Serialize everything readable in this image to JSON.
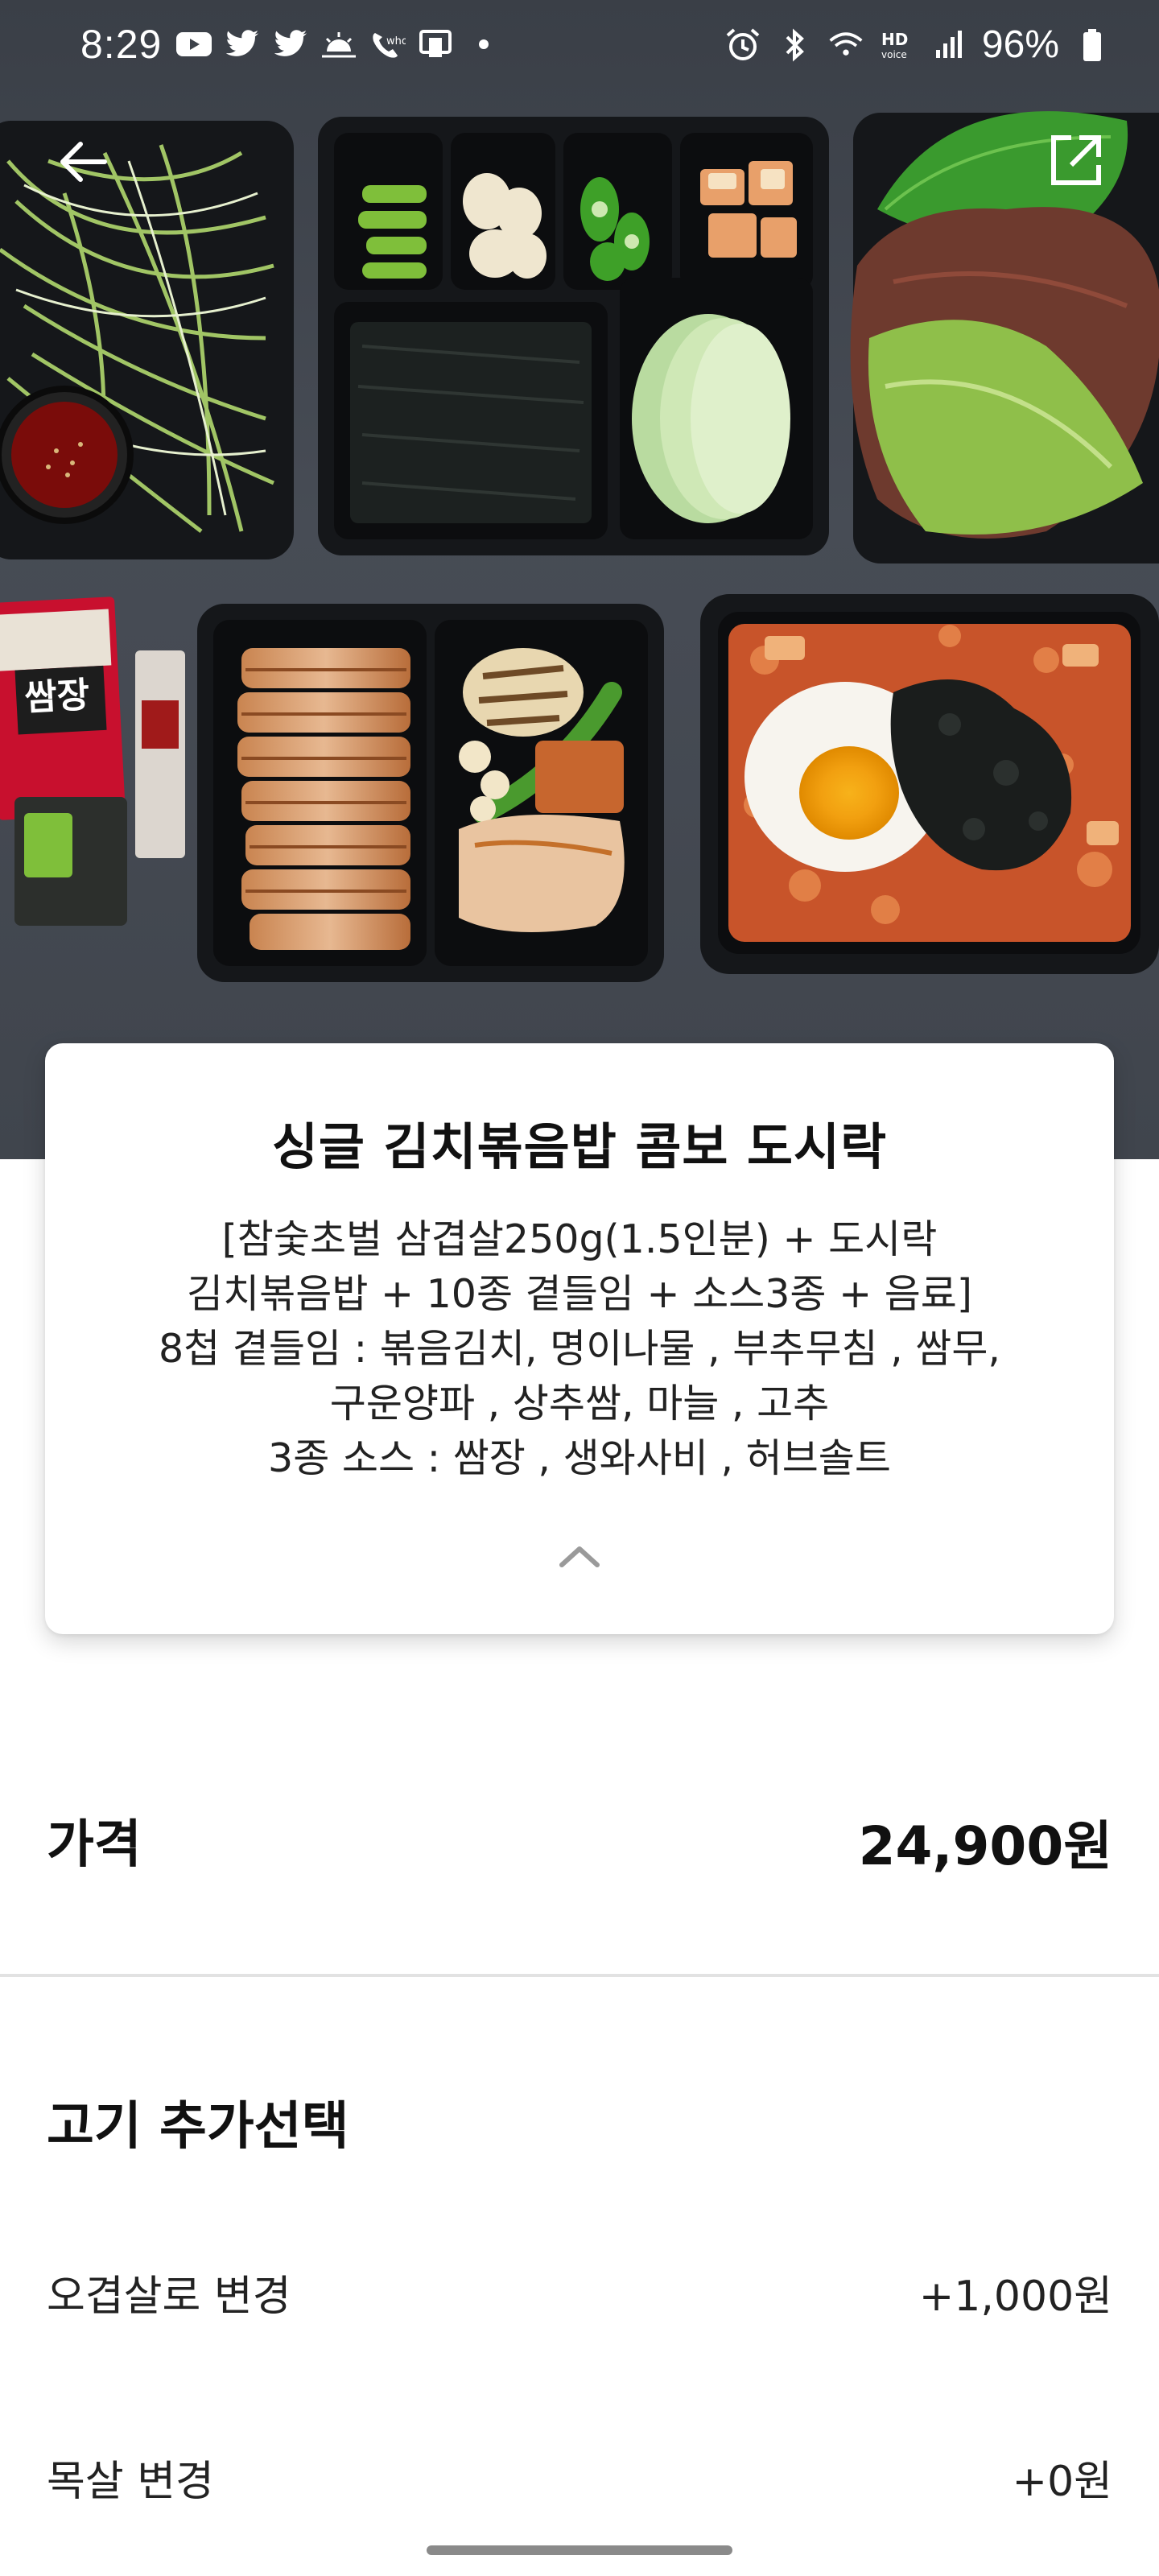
{
  "status_bar": {
    "time": "8:29",
    "battery": "96%",
    "left_icons": [
      "youtube-icon",
      "twitter-icon",
      "twitter-icon",
      "weather-icon",
      "call-icon",
      "cast-icon",
      "dot-icon"
    ],
    "right_icons": [
      "alarm-icon",
      "bluetooth-icon",
      "wifi-icon",
      "hd-voice-icon",
      "signal-icon",
      "battery-icon"
    ]
  },
  "hero": {
    "sauce_label_1": "쌈장"
  },
  "product": {
    "title": "싱글 김치볶음밥 콤보 도시락",
    "description_lines": [
      "[참숯초벌 삼겹살250g(1.5인분) + 도시락",
      "김치볶음밥 + 10종 곁들임 + 소스3종 + 음료]",
      "8첩 곁들임 : 볶음김치, 명이나물 , 부추무침 , 쌈무,",
      "구운양파 , 상추쌈, 마늘 , 고추",
      "3종 소스 : 쌈장 , 생와사비 , 허브솔트"
    ]
  },
  "price": {
    "label": "가격",
    "value": "24,900원"
  },
  "options": {
    "section_title": "고기 추가선택",
    "items": [
      {
        "label": "오겹살로 변경",
        "price": "+1,000원"
      },
      {
        "label": "목살 변경",
        "price": "+0원"
      }
    ]
  },
  "colors": {
    "photo_background": "#444952",
    "tray": "#16181b",
    "divider": "#e2e2e2",
    "text": "#111111"
  }
}
